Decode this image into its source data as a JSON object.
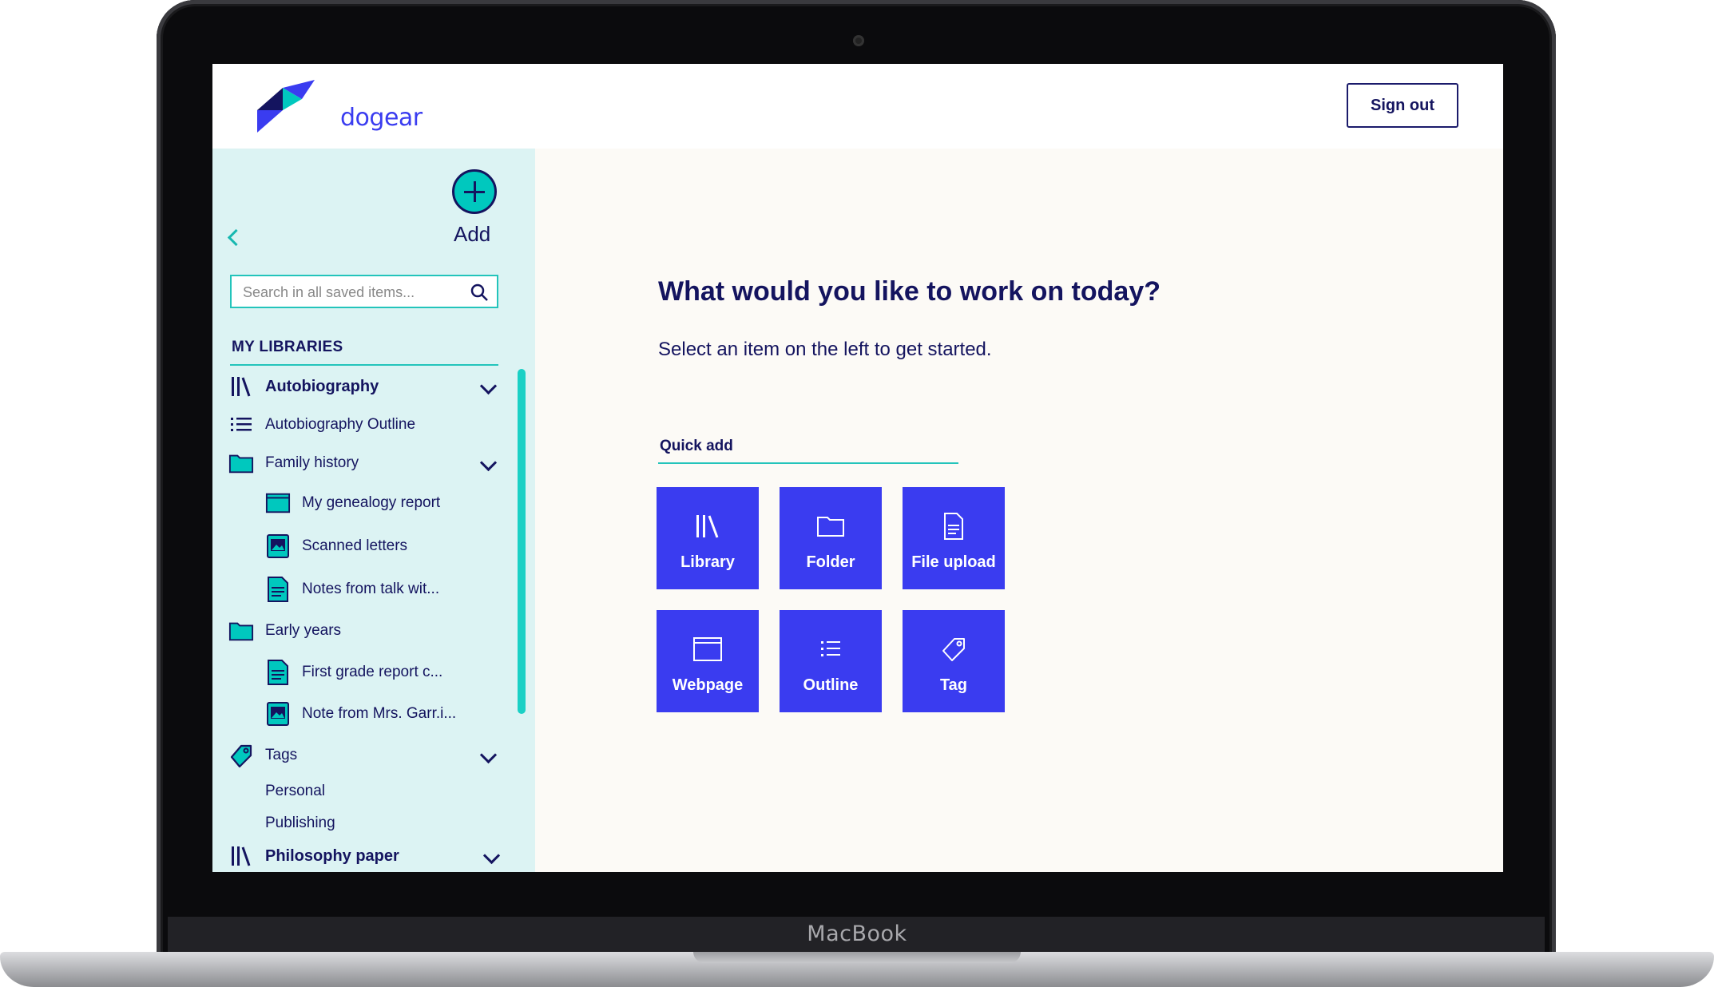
{
  "device": {
    "brand_label": "MacBook"
  },
  "app": {
    "logo_text": "dogear",
    "sign_out_label": "Sign out"
  },
  "sidebar": {
    "add_label": "Add",
    "search_placeholder": "Search in all saved items...",
    "section_title": "MY LIBRARIES",
    "items": [
      {
        "label": "Autobiography",
        "icon": "library-icon"
      },
      {
        "label": "Autobiography Outline",
        "icon": "outline-icon"
      },
      {
        "label": "Family history",
        "icon": "folder-icon"
      },
      {
        "label": "My genealogy report",
        "icon": "webpage-icon"
      },
      {
        "label": "Scanned letters",
        "icon": "image-file-icon"
      },
      {
        "label": "Notes from talk wit...",
        "icon": "document-icon"
      },
      {
        "label": "Early years",
        "icon": "folder-icon"
      },
      {
        "label": "First grade report c...",
        "icon": "document-icon"
      },
      {
        "label": "Note from Mrs. Garr.i...",
        "icon": "image-file-icon"
      },
      {
        "label": "Tags",
        "icon": "tag-icon"
      },
      {
        "label": "Personal"
      },
      {
        "label": "Publishing"
      },
      {
        "label": "Philosophy paper",
        "icon": "library-icon"
      }
    ]
  },
  "main": {
    "title": "What would you like to work on today?",
    "subtitle": "Select an item on the left to get started.",
    "quick_add_label": "Quick add",
    "tiles": [
      {
        "label": "Library",
        "icon": "library-icon"
      },
      {
        "label": "Folder",
        "icon": "folder-icon"
      },
      {
        "label": "File upload",
        "icon": "file-icon"
      },
      {
        "label": "Webpage",
        "icon": "webpage-icon"
      },
      {
        "label": "Outline",
        "icon": "outline-icon"
      },
      {
        "label": "Tag",
        "icon": "tag-icon"
      }
    ]
  },
  "colors": {
    "accent": "#3a3cf0",
    "teal": "#00c8be",
    "navy": "#14145f",
    "sidebar_bg": "#dcf3f3",
    "main_bg": "#fcfaf6"
  }
}
